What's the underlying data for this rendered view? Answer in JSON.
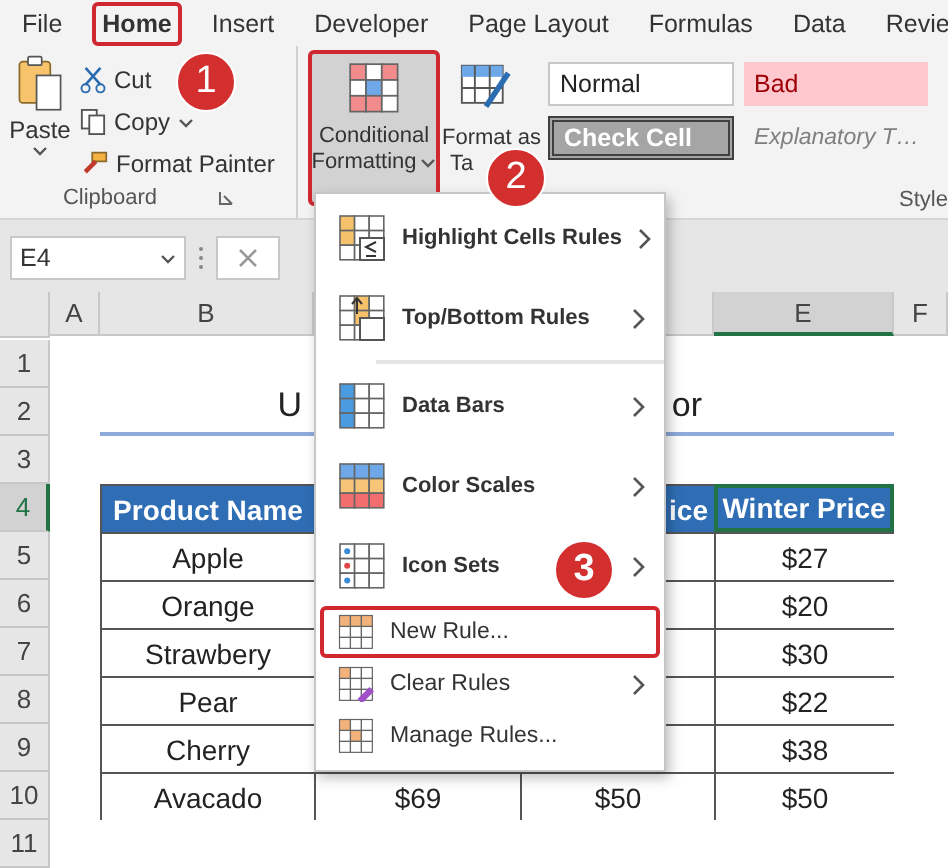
{
  "ribbon_tabs": [
    {
      "label": "File",
      "selected": false,
      "annotated": false
    },
    {
      "label": "Home",
      "selected": true,
      "annotated": true
    },
    {
      "label": "Insert",
      "selected": false,
      "annotated": false
    },
    {
      "label": "Developer",
      "selected": false,
      "annotated": false
    },
    {
      "label": "Page Layout",
      "selected": false,
      "annotated": false
    },
    {
      "label": "Formulas",
      "selected": false,
      "annotated": false
    },
    {
      "label": "Data",
      "selected": false,
      "annotated": false
    },
    {
      "label": "Revie",
      "selected": false,
      "annotated": false
    }
  ],
  "clipboard": {
    "paste": "Paste",
    "cut": "Cut",
    "copy": "Copy",
    "format_painter": "Format Painter",
    "group_label": "Clipboard"
  },
  "conditional_formatting": {
    "line1": "Conditional",
    "line2": "Formatting",
    "annotated": true
  },
  "format_as_table": {
    "line1": "Format as",
    "line2": "Ta"
  },
  "styles": [
    {
      "label": "Normal",
      "kind": "normal"
    },
    {
      "label": "Bad",
      "kind": "bad"
    },
    {
      "label": "Check Cell",
      "kind": "check"
    },
    {
      "label": "Explanatory T…",
      "kind": "explanatory"
    }
  ],
  "styles_group_label": "Style",
  "name_box": "E4",
  "columns": [
    {
      "label": "A",
      "selected": false
    },
    {
      "label": "B",
      "selected": false
    },
    {
      "label": "E",
      "selected": true
    },
    {
      "label": "F",
      "selected": false
    }
  ],
  "rows": [
    {
      "number": "1",
      "kind": "plain",
      "selected": false
    },
    {
      "number": "2",
      "kind": "title",
      "selected": false,
      "b": "U",
      "d": "or"
    },
    {
      "number": "3",
      "kind": "plain",
      "selected": false
    },
    {
      "number": "4",
      "kind": "header",
      "selected": true,
      "b": "Product Name",
      "d": "ice",
      "e": "Winter Price"
    },
    {
      "number": "5",
      "kind": "data",
      "selected": false,
      "b": "Apple",
      "e": "$27"
    },
    {
      "number": "6",
      "kind": "data",
      "selected": false,
      "b": "Orange",
      "e": "$20"
    },
    {
      "number": "7",
      "kind": "data",
      "selected": false,
      "b": "Strawbery",
      "e": "$30"
    },
    {
      "number": "8",
      "kind": "data",
      "selected": false,
      "b": "Pear",
      "e": "$22"
    },
    {
      "number": "9",
      "kind": "data",
      "selected": false,
      "b": "Cherry",
      "e": "$38"
    },
    {
      "number": "10",
      "kind": "data",
      "selected": false,
      "b": "Avacado",
      "c": "$69",
      "d": "$50",
      "e": "$50"
    },
    {
      "number": "11",
      "kind": "plain",
      "selected": false
    }
  ],
  "menu": [
    {
      "label": "Highlight Cells Rules",
      "kind": "large",
      "submenu": true,
      "annotated": false
    },
    {
      "label": "Top/Bottom Rules",
      "kind": "large",
      "submenu": true,
      "annotated": false
    },
    {
      "label": "Data Bars",
      "kind": "large",
      "submenu": true,
      "annotated": false
    },
    {
      "label": "Color Scales",
      "kind": "large",
      "submenu": true,
      "annotated": false
    },
    {
      "label": "Icon Sets",
      "kind": "large",
      "submenu": true,
      "annotated": false
    },
    {
      "label": "New Rule...",
      "kind": "small",
      "submenu": false,
      "annotated": true
    },
    {
      "label": "Clear Rules",
      "kind": "small",
      "submenu": true,
      "annotated": false
    },
    {
      "label": "Manage Rules...",
      "kind": "small",
      "submenu": false,
      "annotated": false
    }
  ],
  "badges": [
    {
      "label": "1"
    },
    {
      "label": "2"
    },
    {
      "label": "3"
    }
  ]
}
